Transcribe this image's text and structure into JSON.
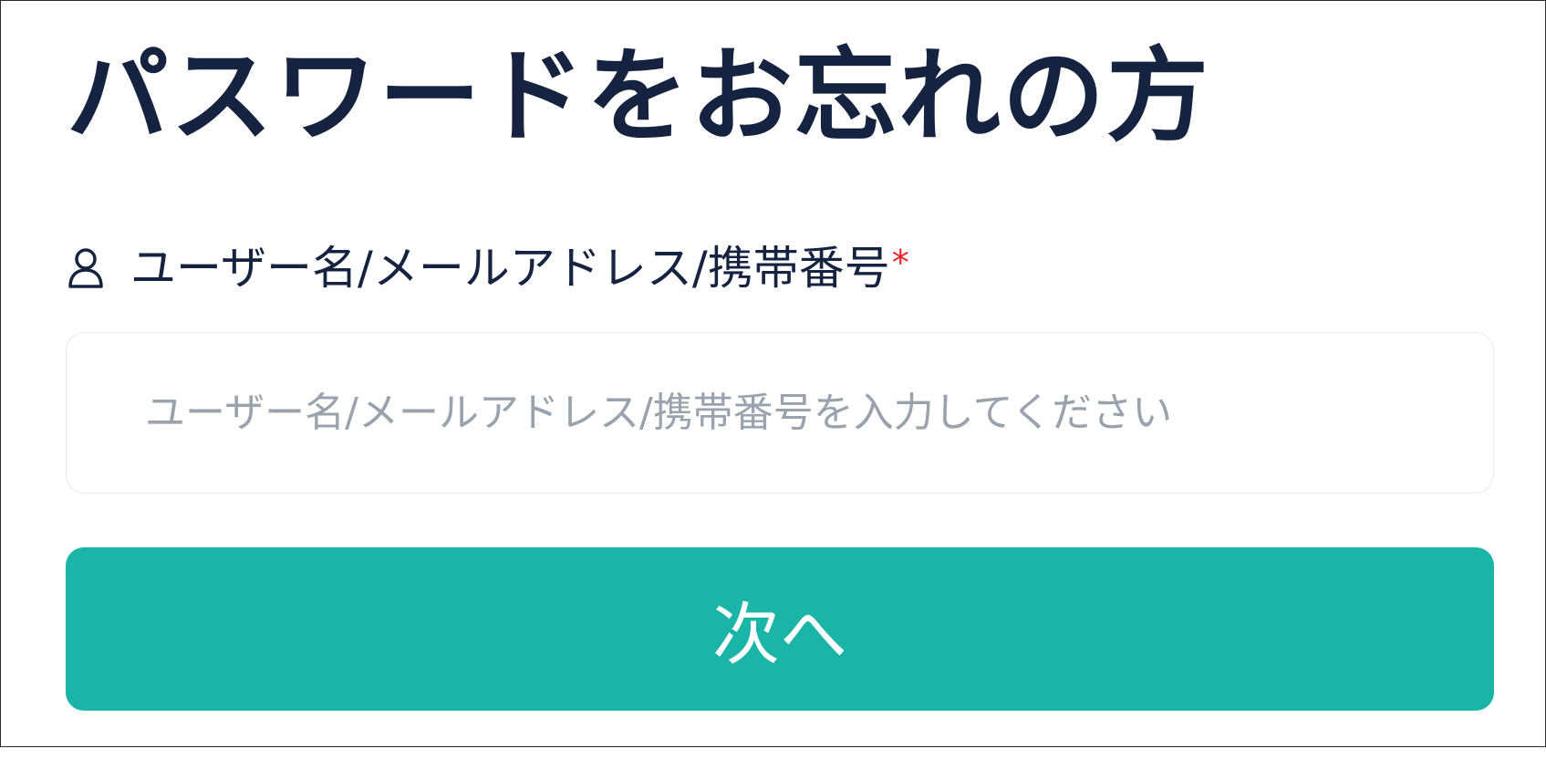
{
  "page": {
    "title": "パスワードをお忘れの方"
  },
  "form": {
    "username": {
      "icon": "user-icon",
      "label": "ユーザー名/メールアドレス/携帯番号",
      "required_mark": "*",
      "value": "",
      "placeholder": "ユーザー名/メールアドレス/携帯番号を入力してください"
    },
    "next_button_label": "次へ"
  },
  "colors": {
    "title": "#152340",
    "required": "#f5222d",
    "placeholder": "#9aa3ad",
    "input_border": "#e7eaee",
    "button_background": "#1ab5a6",
    "button_text": "#ffffff"
  }
}
